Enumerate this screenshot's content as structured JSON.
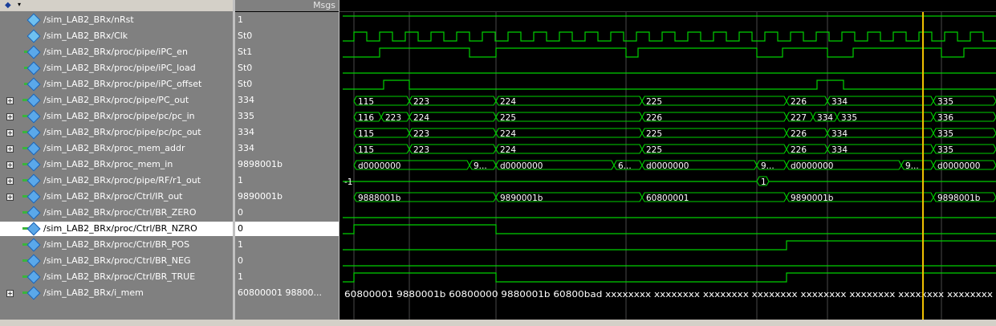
{
  "header": {
    "msgs_label": "Msgs",
    "dropdown_glyph": "▾"
  },
  "signals": [
    {
      "name": "/sim_LAB2_BRx/nRst",
      "value": "1",
      "icon": "signal-input-icon",
      "expand": false
    },
    {
      "name": "/sim_LAB2_BRx/Clk",
      "value": "St0",
      "icon": "signal-input-icon",
      "expand": false
    },
    {
      "name": "/sim_LAB2_BRx/proc/pipe/iPC_en",
      "value": "St1",
      "icon": "signal-inout-icon",
      "expand": false
    },
    {
      "name": "/sim_LAB2_BRx/proc/pipe/iPC_load",
      "value": "St0",
      "icon": "signal-inout-icon",
      "expand": false
    },
    {
      "name": "/sim_LAB2_BRx/proc/pipe/iPC_offset",
      "value": "St0",
      "icon": "signal-inout-icon",
      "expand": false
    },
    {
      "name": "/sim_LAB2_BRx/proc/pipe/PC_out",
      "value": "334",
      "icon": "signal-output-icon",
      "expand": true
    },
    {
      "name": "/sim_LAB2_BRx/proc/pipe/pc/pc_in",
      "value": "335",
      "icon": "signal-output-icon",
      "expand": true
    },
    {
      "name": "/sim_LAB2_BRx/proc/pipe/pc/pc_out",
      "value": "334",
      "icon": "signal-output-icon",
      "expand": true
    },
    {
      "name": "/sim_LAB2_BRx/proc_mem_addr",
      "value": "334",
      "icon": "signal-output-icon",
      "expand": true
    },
    {
      "name": "/sim_LAB2_BRx/proc_mem_in",
      "value": "9898001b",
      "icon": "signal-output-icon",
      "expand": true
    },
    {
      "name": "/sim_LAB2_BRx/proc/pipe/RF/r1_out",
      "value": "1",
      "icon": "signal-output-icon",
      "expand": true
    },
    {
      "name": "/sim_LAB2_BRx/proc/Ctrl/IR_out",
      "value": "9890001b",
      "icon": "signal-output-icon",
      "expand": true
    },
    {
      "name": "/sim_LAB2_BRx/proc/Ctrl/BR_ZERO",
      "value": "0",
      "icon": "signal-output-icon",
      "expand": false
    },
    {
      "name": "/sim_LAB2_BRx/proc/Ctrl/BR_NZRO",
      "value": "0",
      "icon": "signal-output-icon",
      "expand": false,
      "selected": true
    },
    {
      "name": "/sim_LAB2_BRx/proc/Ctrl/BR_POS",
      "value": "1",
      "icon": "signal-output-icon",
      "expand": false
    },
    {
      "name": "/sim_LAB2_BRx/proc/Ctrl/BR_NEG",
      "value": "0",
      "icon": "signal-output-icon",
      "expand": false
    },
    {
      "name": "/sim_LAB2_BRx/proc/Ctrl/BR_TRUE",
      "value": "1",
      "icon": "signal-output-icon",
      "expand": false
    },
    {
      "name": "/sim_LAB2_BRx/i_mem",
      "value": "60800001 98800...",
      "icon": "signal-output-icon",
      "expand": true
    }
  ],
  "wave_labels": {
    "PC_out": [
      "115",
      "223",
      "224",
      "225",
      "226",
      "334",
      "335"
    ],
    "pc_in": [
      "116",
      "223",
      "224",
      "225",
      "226",
      "227",
      "334",
      "335",
      "336"
    ],
    "pc_out": [
      "115",
      "223",
      "224",
      "225",
      "226",
      "334",
      "335"
    ],
    "proc_mem_addr": [
      "115",
      "223",
      "224",
      "225",
      "226",
      "334",
      "335"
    ],
    "proc_mem_in": [
      "d0000000",
      "9...",
      "d0000000",
      "6...",
      "d0000000",
      "9...",
      "d0000000",
      "9...",
      "d0000000"
    ],
    "r1_out": [
      "-1",
      "1"
    ],
    "IR_out": [
      "9888001b",
      "9890001b",
      "60800001",
      "9890001b",
      "9898001b"
    ],
    "i_mem": "60800001 9880001b 60800000 9880001b 60800bad xxxxxxxx xxxxxxxx xxxxxxxx xxxxxxxx xxxxxxxx xxxxxxxx xxxxxxxx xxxxxxxx"
  },
  "colors": {
    "wave": "#00d000",
    "cursor": "#f0c000",
    "grid": "#7a7a7a",
    "text": "#ffffff"
  }
}
